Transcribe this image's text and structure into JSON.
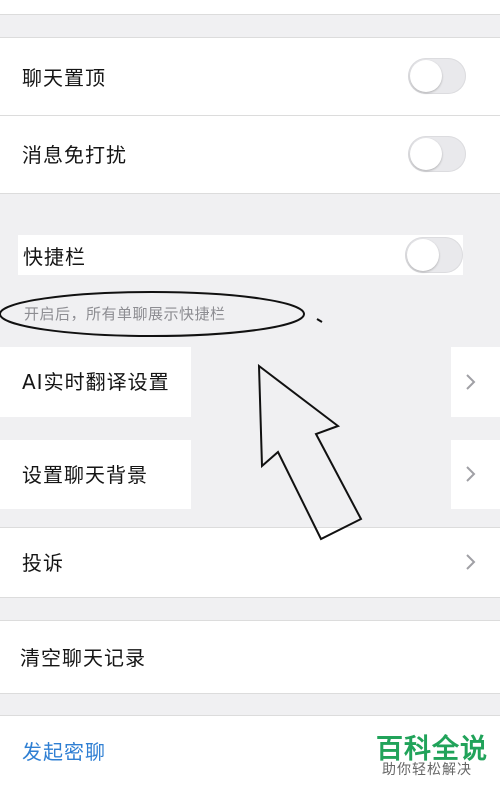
{
  "settings": {
    "pin_chat": {
      "label": "聊天置顶",
      "enabled": false
    },
    "mute_notifications": {
      "label": "消息免打扰",
      "enabled": false
    },
    "quick_bar": {
      "label": "快捷栏",
      "enabled": false,
      "hint": "开启后，所有单聊展示快捷栏"
    },
    "ai_translate": {
      "label": "AI实时翻译设置"
    },
    "chat_background": {
      "label": "设置聊天背景"
    },
    "report": {
      "label": "投诉"
    },
    "clear_history": {
      "label": "清空聊天记录"
    },
    "start_secret_chat": {
      "label": "发起密聊",
      "color": "#2f7fd3"
    }
  },
  "watermark": {
    "title": "百科全说",
    "subtitle": "助你轻松解决",
    "color": "#21a35a"
  },
  "colors": {
    "background": "#f0f0f2",
    "row": "#ffffff",
    "hint_text": "#8d8d92",
    "toggle_off": "#e9e9ec"
  },
  "icons": [
    "chevron-right-icon",
    "arrow-annotation-icon",
    "ellipse-annotation-icon"
  ]
}
